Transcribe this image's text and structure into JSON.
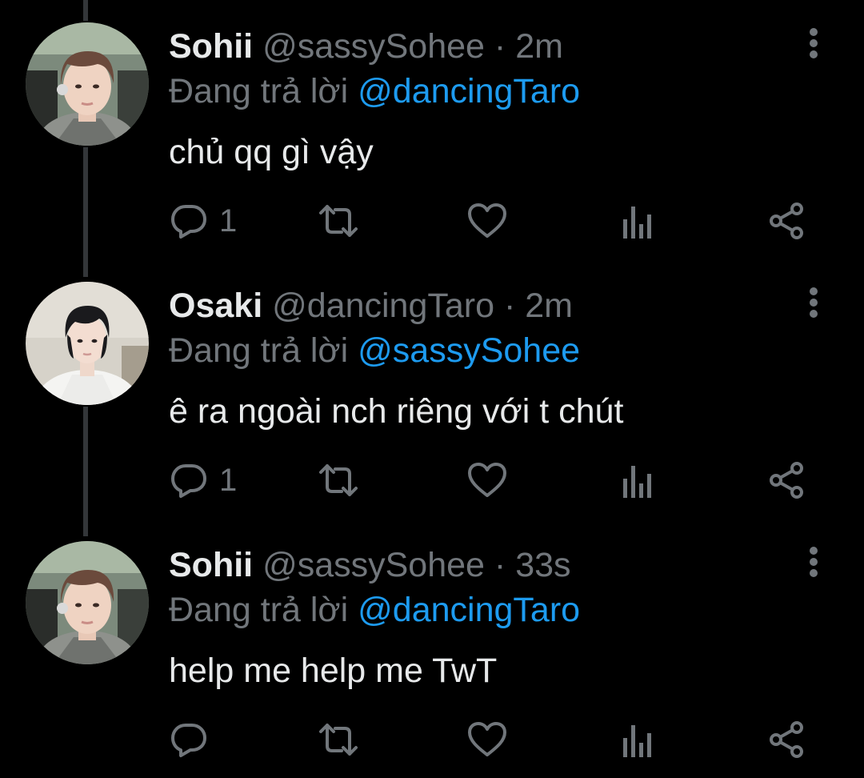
{
  "colors": {
    "background": "#000000",
    "text": "#e7e9ea",
    "muted": "#71767b",
    "accent": "#1d9bf0",
    "thread_line": "#333639"
  },
  "tweets": [
    {
      "display_name": "Sohii",
      "handle": "@sassySohee",
      "separator": "·",
      "time": "2m",
      "replying_label": "Đang trả lời",
      "replying_to": "@dancingTaro",
      "text": "chủ qq gì vậy",
      "reply_count": "1",
      "avatar": "avatar-sohii"
    },
    {
      "display_name": "Osaki",
      "handle": "@dancingTaro",
      "separator": "·",
      "time": "2m",
      "replying_label": "Đang trả lời",
      "replying_to": "@sassySohee",
      "text": "ê ra ngoài nch riêng với t chút",
      "reply_count": "1",
      "avatar": "avatar-osaki"
    },
    {
      "display_name": "Sohii",
      "handle": "@sassySohee",
      "separator": "·",
      "time": "33s",
      "replying_label": "Đang trả lời",
      "replying_to": "@dancingTaro",
      "text": "help me help me TwT",
      "reply_count": "",
      "avatar": "avatar-sohii"
    }
  ],
  "icons": {
    "reply": "reply-icon",
    "retweet": "retweet-icon",
    "like": "heart-icon",
    "views": "analytics-icon",
    "share": "share-icon",
    "more": "more-vertical-icon"
  }
}
